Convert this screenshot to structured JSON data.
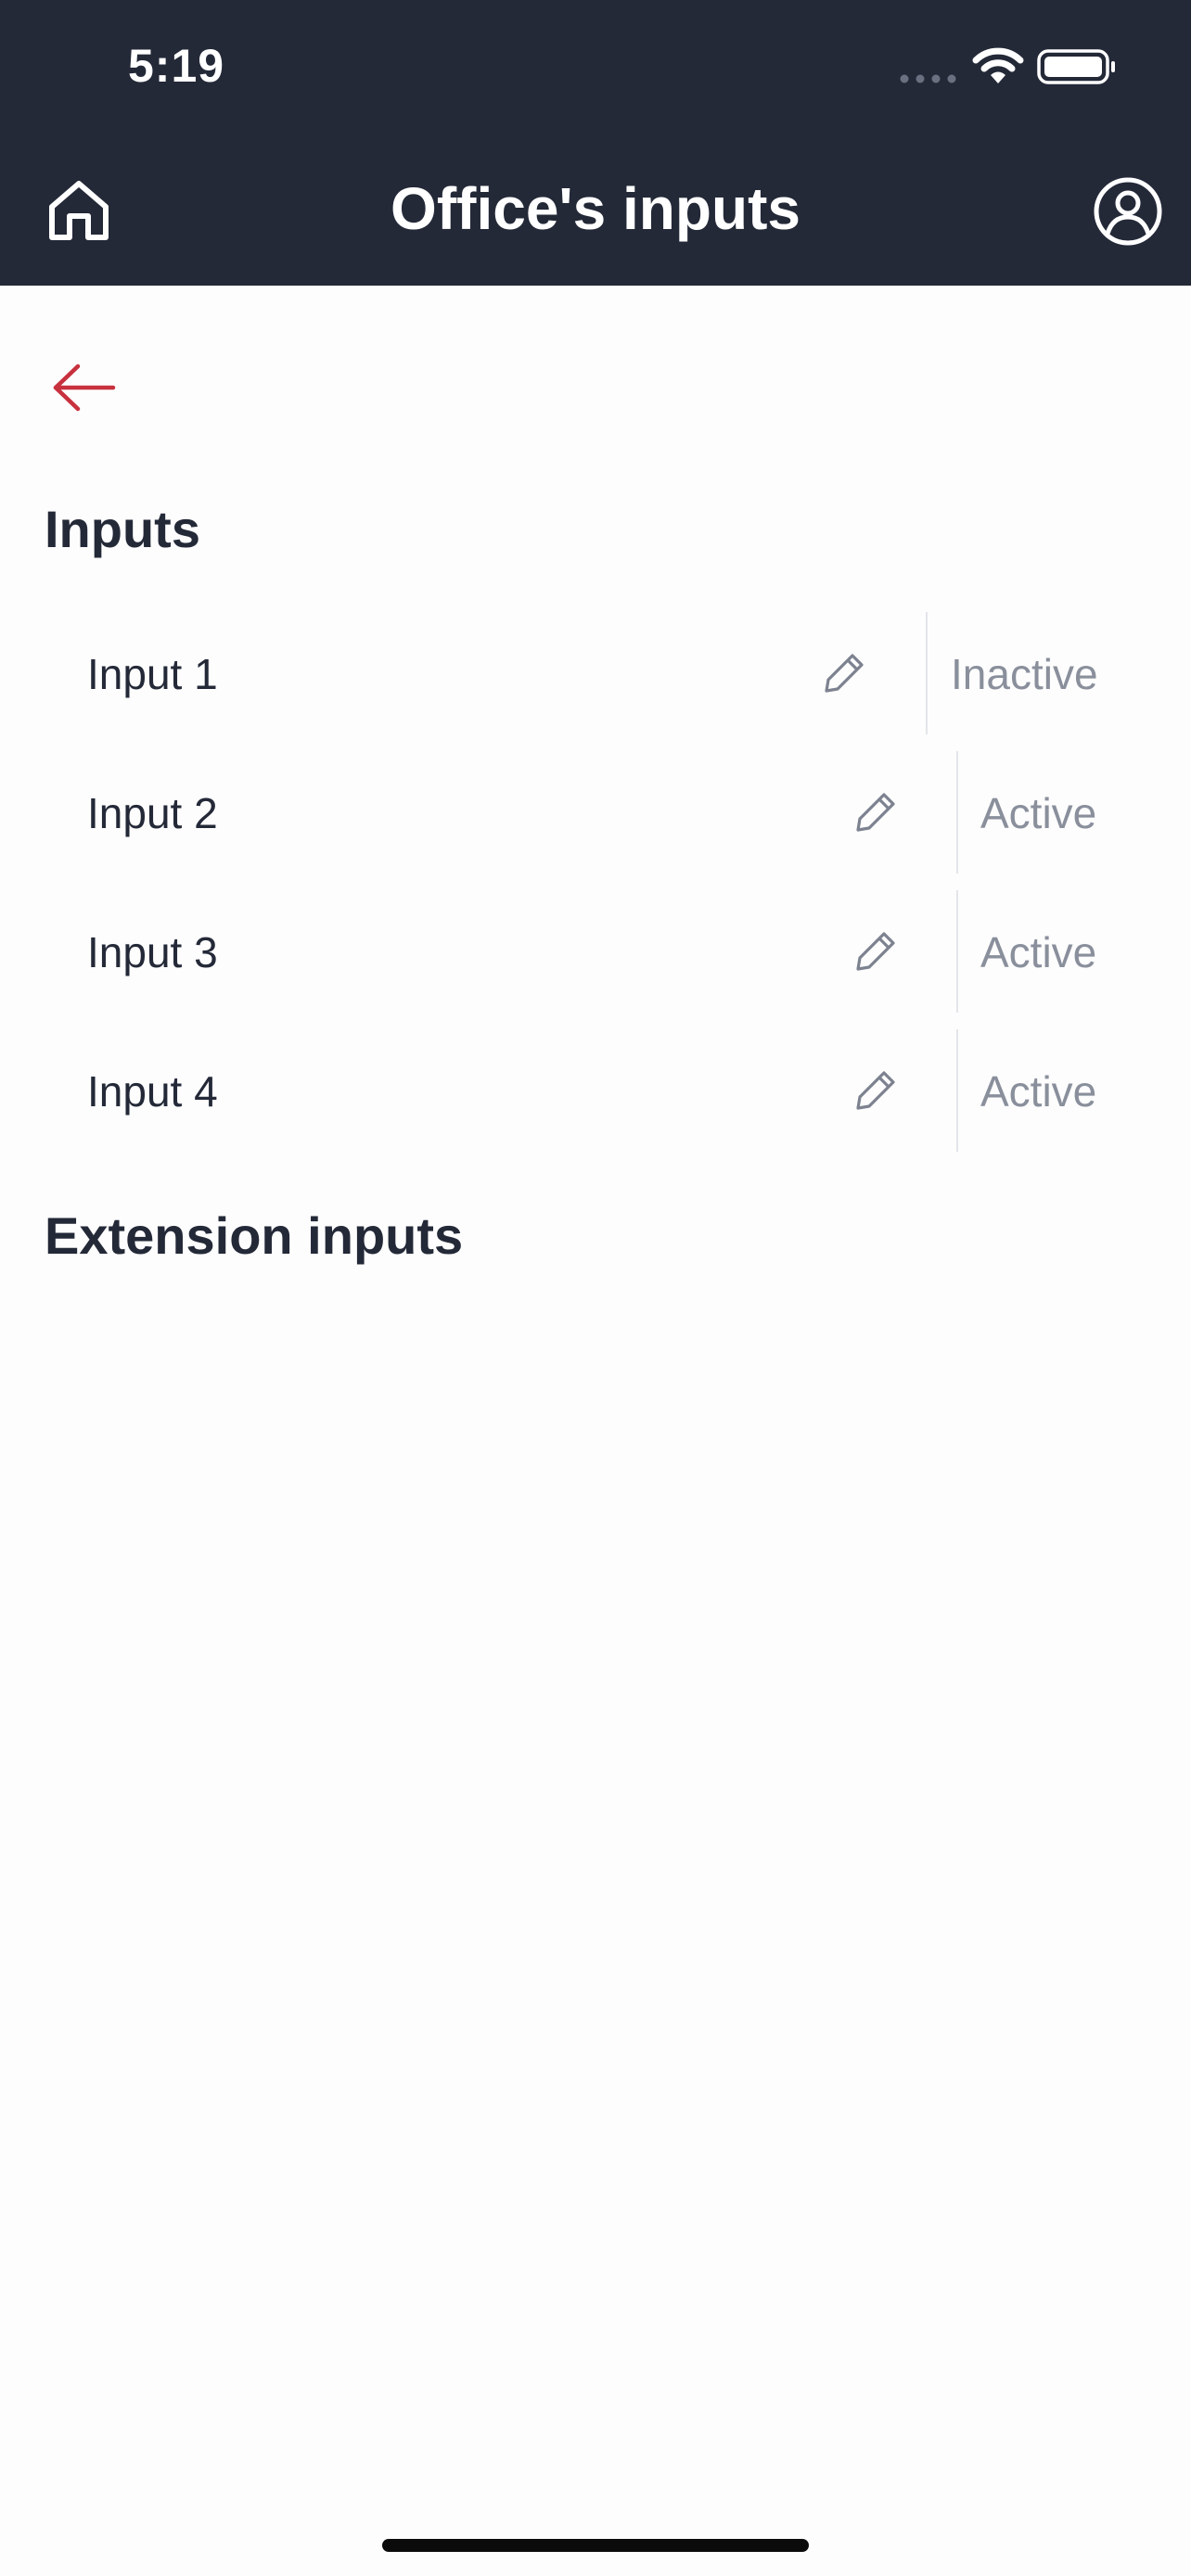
{
  "status_bar": {
    "time": "5:19"
  },
  "header": {
    "title": "Office's inputs",
    "home_icon": "home-icon",
    "profile_icon": "profile-icon"
  },
  "back_icon": "arrow-left-icon",
  "colors": {
    "header_bg": "#242938",
    "back_arrow": "#c8313e",
    "text_primary": "#242938",
    "text_status": "#8a8f9c"
  },
  "sections": {
    "inputs_title": "Inputs",
    "extension_title": "Extension inputs"
  },
  "inputs": [
    {
      "label": "Input 1",
      "status": "Inactive"
    },
    {
      "label": "Input 2",
      "status": "Active"
    },
    {
      "label": "Input 3",
      "status": "Active"
    },
    {
      "label": "Input 4",
      "status": "Active"
    }
  ]
}
